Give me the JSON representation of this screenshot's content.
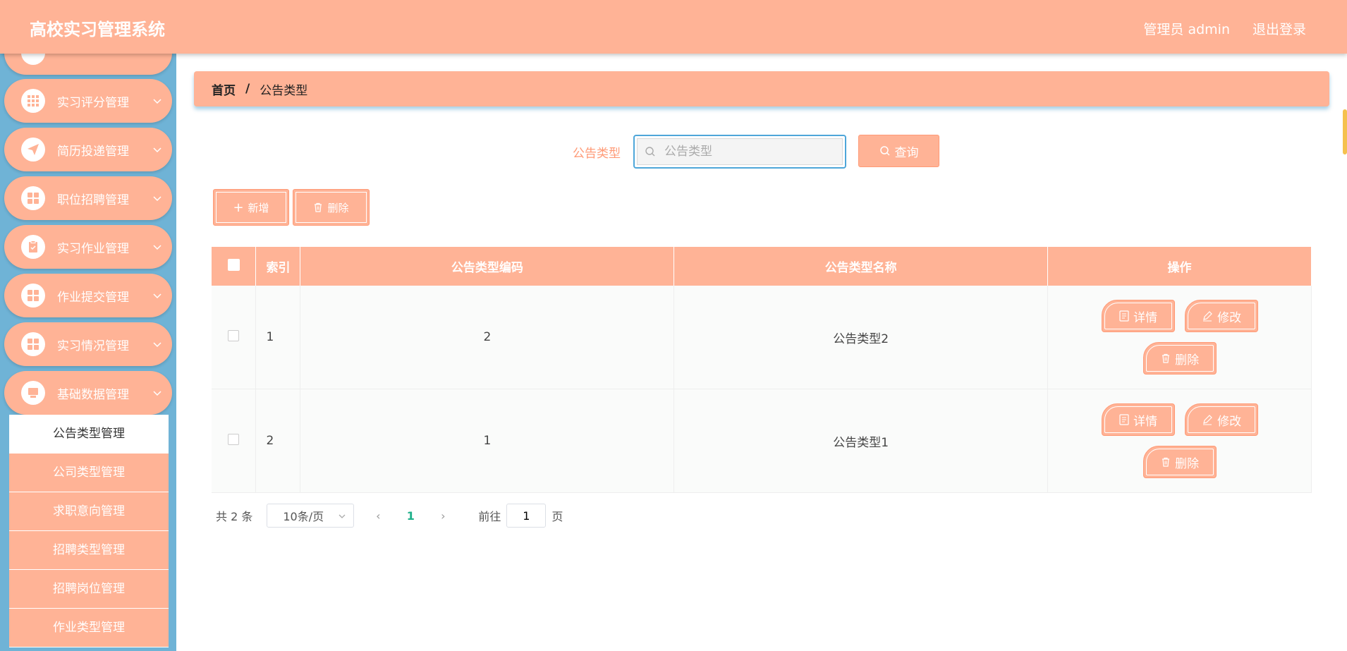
{
  "header": {
    "title": "高校实习管理系统",
    "user": "管理员 admin",
    "logout": "退出登录"
  },
  "sidebar": {
    "menus": [
      {
        "label": "实习评分管理",
        "icon": "grid-icon"
      },
      {
        "label": "简历投递管理",
        "icon": "send-icon"
      },
      {
        "label": "职位招聘管理",
        "icon": "apps-icon"
      },
      {
        "label": "实习作业管理",
        "icon": "clipboard-icon"
      },
      {
        "label": "作业提交管理",
        "icon": "apps-icon"
      },
      {
        "label": "实习情况管理",
        "icon": "apps-icon"
      },
      {
        "label": "基础数据管理",
        "icon": "monitor-icon"
      }
    ],
    "submenu": [
      {
        "label": "公告类型管理",
        "active": true
      },
      {
        "label": "公司类型管理"
      },
      {
        "label": "求职意向管理"
      },
      {
        "label": "招聘类型管理"
      },
      {
        "label": "招聘岗位管理"
      },
      {
        "label": "作业类型管理"
      }
    ]
  },
  "breadcrumb": {
    "home": "首页",
    "separator": "/",
    "current": "公告类型"
  },
  "search": {
    "label": "公告类型",
    "placeholder": "公告类型",
    "value": "",
    "button": "查询"
  },
  "toolbar": {
    "add": "新增",
    "delete": "删除"
  },
  "table": {
    "headers": [
      "索引",
      "公告类型编码",
      "公告类型名称",
      "操作"
    ],
    "rows": [
      {
        "index": "1",
        "code": "2",
        "name": "公告类型2"
      },
      {
        "index": "2",
        "code": "1",
        "name": "公告类型1"
      }
    ],
    "ops": {
      "detail": "详情",
      "edit": "修改",
      "delete": "删除"
    }
  },
  "pagination": {
    "total": "共 2 条",
    "page_size": "10条/页",
    "current_page": "1",
    "goto_label": "前往",
    "goto_value": "1",
    "page_suffix": "页"
  },
  "colors": {
    "primary": "#ffb396",
    "sidebar": "#6fb3d6",
    "accent": "#ff9a76",
    "page_active": "#1fb08a"
  }
}
